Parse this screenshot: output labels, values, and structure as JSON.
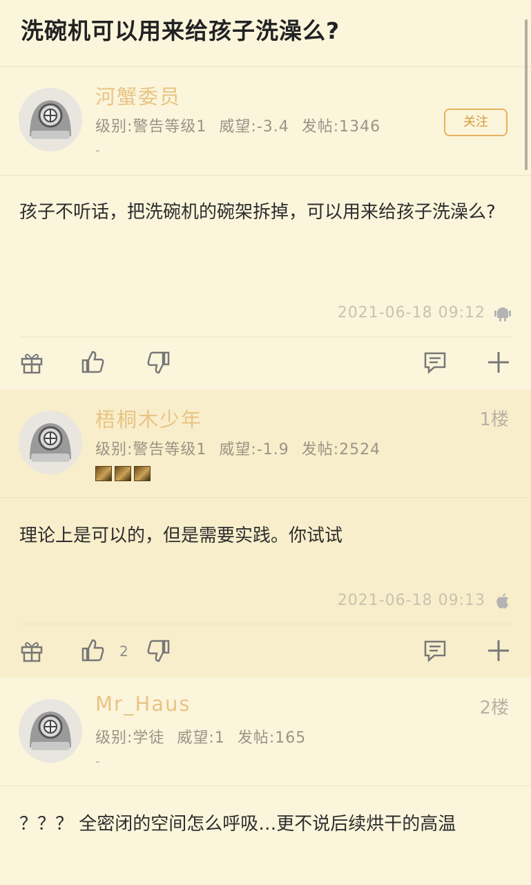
{
  "page": {
    "title": "洗碗机可以用来给孩子洗澡么?"
  },
  "op": {
    "username": "河蟹委员",
    "level": "级别:警告等级1",
    "reputation": "威望:-3.4",
    "posts": "发帖:1346",
    "signature": "-",
    "follow_label": "关注",
    "content": "孩子不听话，把洗碗机的碗架拆掉，可以用来给孩子洗澡么?",
    "timestamp": "2021-06-18 09:12",
    "platform_icon": "android-icon"
  },
  "replies": [
    {
      "username": "梧桐木少年",
      "floor": "1楼",
      "level": "级别:警告等级1",
      "reputation": "威望:-1.9",
      "posts": "发帖:2524",
      "content": "理论上是可以的，但是需要实践。你试试",
      "timestamp": "2021-06-18 09:13",
      "platform_icon": "apple-icon",
      "like_count": "2"
    },
    {
      "username": "Mr_Haus",
      "floor": "2楼",
      "level": "级别:学徒",
      "reputation": "威望:1",
      "posts": "发帖:165",
      "signature": "-",
      "content": "？？？ 全密闭的空间怎么呼吸…更不说后续烘干的高温"
    }
  ],
  "colors": {
    "background": "#fbf5dc",
    "alt_background": "#f8eecb",
    "username": "#e8c484",
    "follow": "#e7b25c"
  }
}
